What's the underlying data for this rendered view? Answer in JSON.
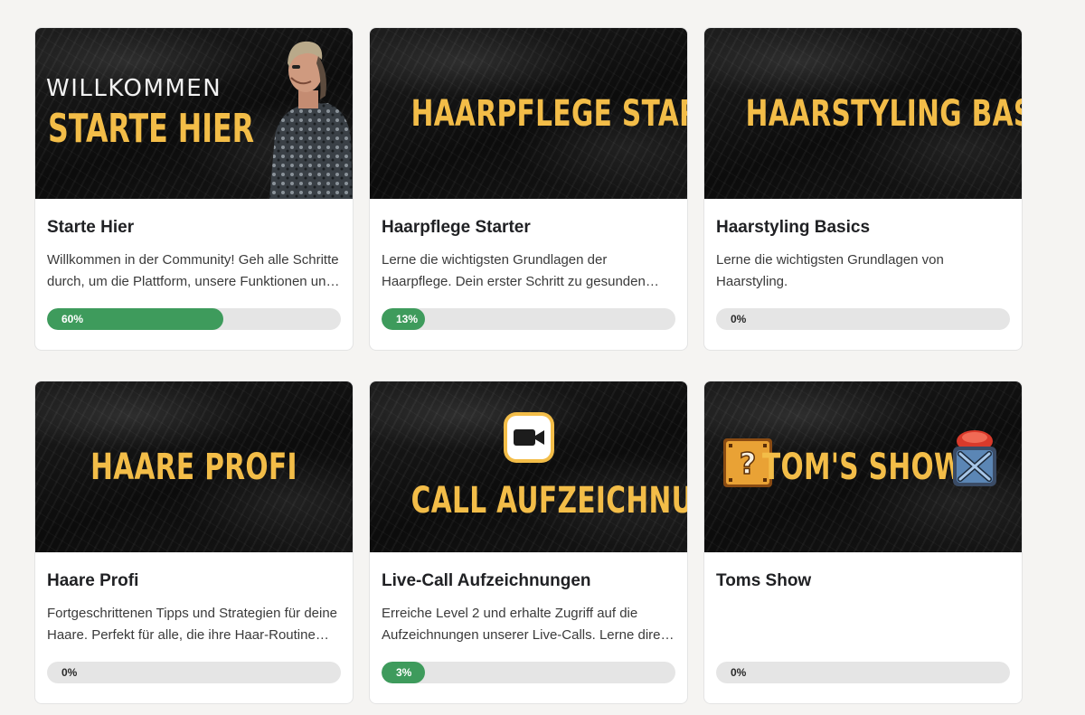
{
  "courses": [
    {
      "thumb_small": "WILLKOMMEN",
      "thumb_title": "STARTE HIER",
      "title": "Starte Hier",
      "description": "Willkommen in der Community! Geh alle Schritte durch, um die Plattform, unsere Funktionen und alles kennenzulernen.",
      "progress": 60,
      "progress_label": "60%"
    },
    {
      "thumb_title": "HAARPFLEGE STARTER",
      "title": "Haarpflege Starter",
      "description": "Lerne die wichtigsten Grundlagen der Haarpflege. Dein erster Schritt zu gesunden Haaren.",
      "progress": 13,
      "progress_label": "13%"
    },
    {
      "thumb_title": "HAARSTYLING BASICS",
      "title": "Haarstyling Basics",
      "description": "Lerne die wichtigsten Grundlagen von Haarstyling.",
      "progress": 0,
      "progress_label": "0%"
    },
    {
      "thumb_title": "HAARE PROFI",
      "title": "Haare Profi",
      "description": "Fortgeschrittenen Tipps und Strategien für deine Haare. Perfekt für alle, die ihre Haar-Routine verbessern wollen.",
      "progress": 0,
      "progress_label": "0%"
    },
    {
      "thumb_title": "CALL AUFZEICHNUNGEN",
      "title": "Live-Call Aufzeichnungen",
      "description": "Erreiche Level 2 und erhalte Zugriff auf die Aufzeichnungen unserer Live-Calls. Lerne direkt aus den Fragen anderer.",
      "progress": 3,
      "progress_label": "3%"
    },
    {
      "thumb_title": "TOM'S SHOW",
      "title": "Toms Show",
      "description": "",
      "progress": 0,
      "progress_label": "0%"
    }
  ],
  "colors": {
    "accent_yellow": "#f3bd48",
    "progress_green": "#3e9b5c",
    "progress_track": "#e5e5e5"
  },
  "icons": {
    "card_1": "presenter-photo",
    "card_5": "video-camera-icon",
    "card_6_left": "question-block-icon",
    "card_6_right": "red-button-icon"
  }
}
